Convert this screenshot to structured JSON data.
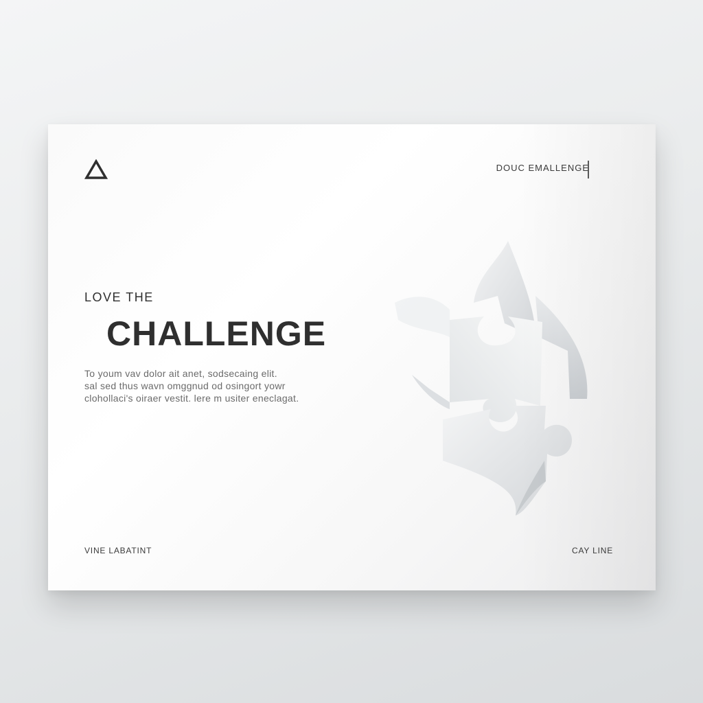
{
  "header": {
    "logo_icon": "triangle-icon",
    "top_right_label": "DOUC EMALLENGE"
  },
  "hero": {
    "eyebrow": "LOVE THE",
    "headline": "CHALLENGE",
    "body_lines": [
      "To youm vav dolor ait anet, sodsecaing elit.",
      "sal sed thus wavn omggnud od osingort yowr",
      "clohollaci's oiraer vestit. lere m usiter eneclagat."
    ]
  },
  "footer": {
    "left_label": "VINE LABATINT",
    "right_label": "CAY LINE"
  },
  "illustration": {
    "icon": "puzzle-arrow-icon"
  },
  "colors": {
    "text_dark": "#2f2f2f",
    "text_muted": "#6a6a6a",
    "card_bg": "#ffffff",
    "page_bg": "#e9ebec"
  }
}
